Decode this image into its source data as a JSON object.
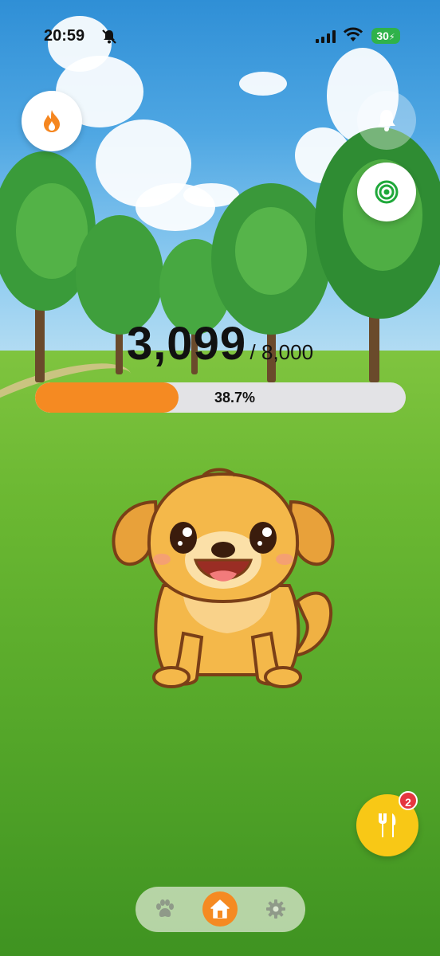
{
  "status_bar": {
    "time": "20:59",
    "battery": "30",
    "icons": [
      "bell-off-icon",
      "signal-icon",
      "wifi-icon",
      "battery-charging-icon"
    ]
  },
  "progress": {
    "current": "3,099",
    "goal": "/ 8,000",
    "percent_label": "38.7%",
    "fraction": 0.387
  },
  "actions": {
    "streak_icon": "flame-icon",
    "notify_icon": "bell-icon",
    "goal_icon": "target-icon",
    "feed_icon": "fork-knife-icon",
    "feed_badge": "2"
  },
  "nav": {
    "items": [
      {
        "icon": "paw-icon"
      },
      {
        "icon": "home-icon",
        "active": true
      },
      {
        "icon": "gear-icon"
      }
    ]
  },
  "colors": {
    "accent": "#f58a22",
    "feed_button": "#f8c816",
    "badge": "#e5363f",
    "goal_ring": "#1fa83a"
  }
}
